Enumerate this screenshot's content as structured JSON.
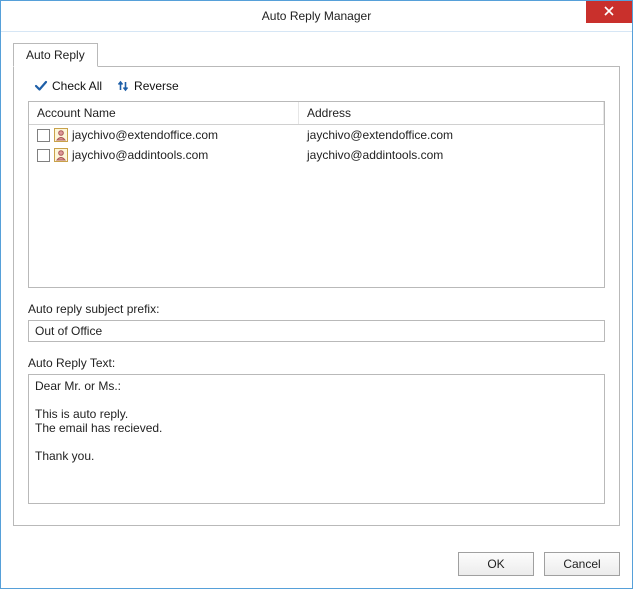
{
  "window": {
    "title": "Auto Reply Manager"
  },
  "tab": {
    "label": "Auto Reply"
  },
  "toolbar": {
    "check_all": "Check All",
    "reverse": "Reverse"
  },
  "list": {
    "col_name": "Account Name",
    "col_address": "Address",
    "rows": [
      {
        "name": "jaychivo@extendoffice.com",
        "address": "jaychivo@extendoffice.com"
      },
      {
        "name": "jaychivo@addintools.com",
        "address": "jaychivo@addintools.com"
      }
    ]
  },
  "subject_prefix": {
    "label": "Auto reply subject prefix:",
    "value": "Out of Office"
  },
  "reply_text": {
    "label": "Auto Reply Text:",
    "value": "Dear Mr. or Ms.:\n\nThis is auto reply.\nThe email has recieved.\n\nThank you."
  },
  "buttons": {
    "ok": "OK",
    "cancel": "Cancel"
  }
}
